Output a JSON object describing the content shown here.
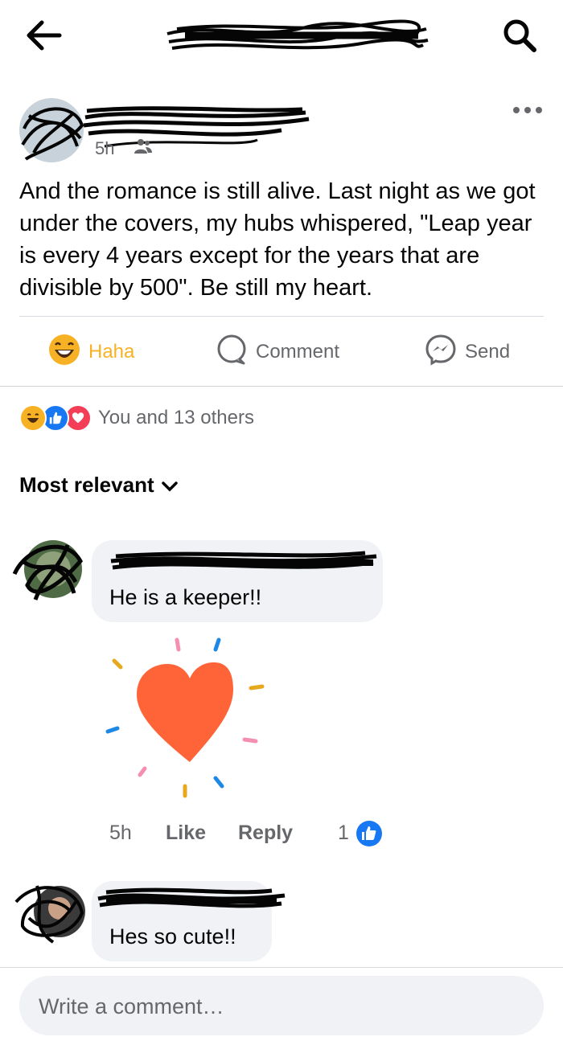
{
  "header": {
    "back_icon": "back-arrow-icon",
    "title_redacted": true,
    "search_icon": "search-icon"
  },
  "post": {
    "author_redacted": true,
    "time": "5h",
    "audience_icon": "friends-icon",
    "more_icon": "more-options-icon",
    "text": "And the romance is still alive.  Last night as we got under the covers, my hubs whispered, \"Leap year is every 4 years except for the years that are divisible by 500\".  Be still my heart.",
    "actions": {
      "haha_label": "Haha",
      "comment_label": "Comment",
      "send_label": "Send"
    },
    "reactions_text": "You and 13 others"
  },
  "comments_section": {
    "sort_label": "Most relevant",
    "comments": [
      {
        "author_redacted": true,
        "text": "He is a keeper!!",
        "sticker": "heart-sticker",
        "time": "5h",
        "like_label": "Like",
        "reply_label": "Reply",
        "like_count": "1"
      },
      {
        "author_redacted": true,
        "text": "Hes so cute!!"
      }
    ]
  },
  "composer": {
    "placeholder": "Write a comment…"
  },
  "colors": {
    "accent_blue": "#1877f2",
    "haha_yellow": "#f7b125",
    "love_red": "#f33e58",
    "muted_text": "#65676b",
    "bubble_bg": "#f0f2f5",
    "heart_orange": "#ff6438"
  }
}
